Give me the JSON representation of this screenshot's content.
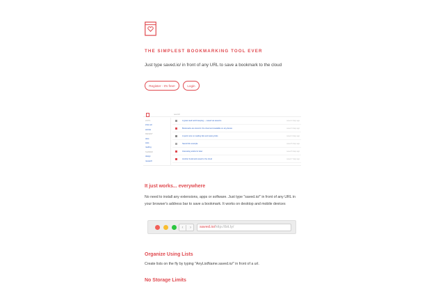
{
  "hero": {
    "title": "THE SIMPLEST BOOKMARKING TOOL EVER",
    "subtitle": "Just type saved.io/ in front of any URL to save a bookmark to the cloud",
    "register_label": "Register - It's free!",
    "login_label": "Login"
  },
  "app_preview": {
    "search_placeholder": "search",
    "sidebar": [
      {
        "text": "LISTS",
        "kind": "heading"
      },
      {
        "text": "inbox all",
        "kind": "link"
      },
      {
        "text": "articles",
        "kind": "link"
      },
      {
        "text": "RECENT",
        "kind": "heading"
      },
      {
        "text": "docs",
        "kind": "link"
      },
      {
        "text": "tools",
        "kind": "link"
      },
      {
        "text": "reading",
        "kind": "link"
      },
      {
        "text": "SHARED",
        "kind": "heading"
      },
      {
        "text": "design",
        "kind": "link"
      },
      {
        "text": "research",
        "kind": "link"
      }
    ],
    "bookmarks": [
      {
        "title": "A great read worth keeping — saved via saved.io",
        "date": "saved 2 days ago",
        "color": "#999999"
      },
      {
        "title": "Bookmarks are stored in the cloud and available on any device",
        "date": "saved 3 days ago",
        "color": "#e0494f"
      },
      {
        "title": "A quick note on reading lists and saving links",
        "date": "saved 4 days ago",
        "color": "#888888"
      },
      {
        "title": "Saved link example",
        "date": "saved 5 days ago",
        "color": "#aaaaaa"
      },
      {
        "title": "Interesting article for later",
        "date": "saved 6 days ago",
        "color": "#e0494f"
      },
      {
        "title": "Another bookmark saved to the cloud",
        "date": "saved 7 days ago",
        "color": "#e0494f"
      }
    ]
  },
  "sections": {
    "works_title": "It just works... everywhere",
    "works_text": "No need to install any extensions, apps or software. Just type \"saved.io/\" in front of any URL in your browser's address bar to save a bookmark. It works on desktop and mobile devices",
    "lists_title": "Organize Using Lists",
    "lists_text": "Create lists on the fly by typing \"AnyListName.saved.io/\" in front of a url.",
    "storage_title": "No Storage Limits"
  },
  "browser_demo": {
    "url_prefix": "saved.io/",
    "url_rest": "http://bit.ly/",
    "back_glyph": "‹",
    "forward_glyph": "›"
  },
  "colors": {
    "accent": "#e0494f",
    "link": "#2a62c9"
  },
  "icons": {
    "logo": "bookmark-heart-icon"
  }
}
